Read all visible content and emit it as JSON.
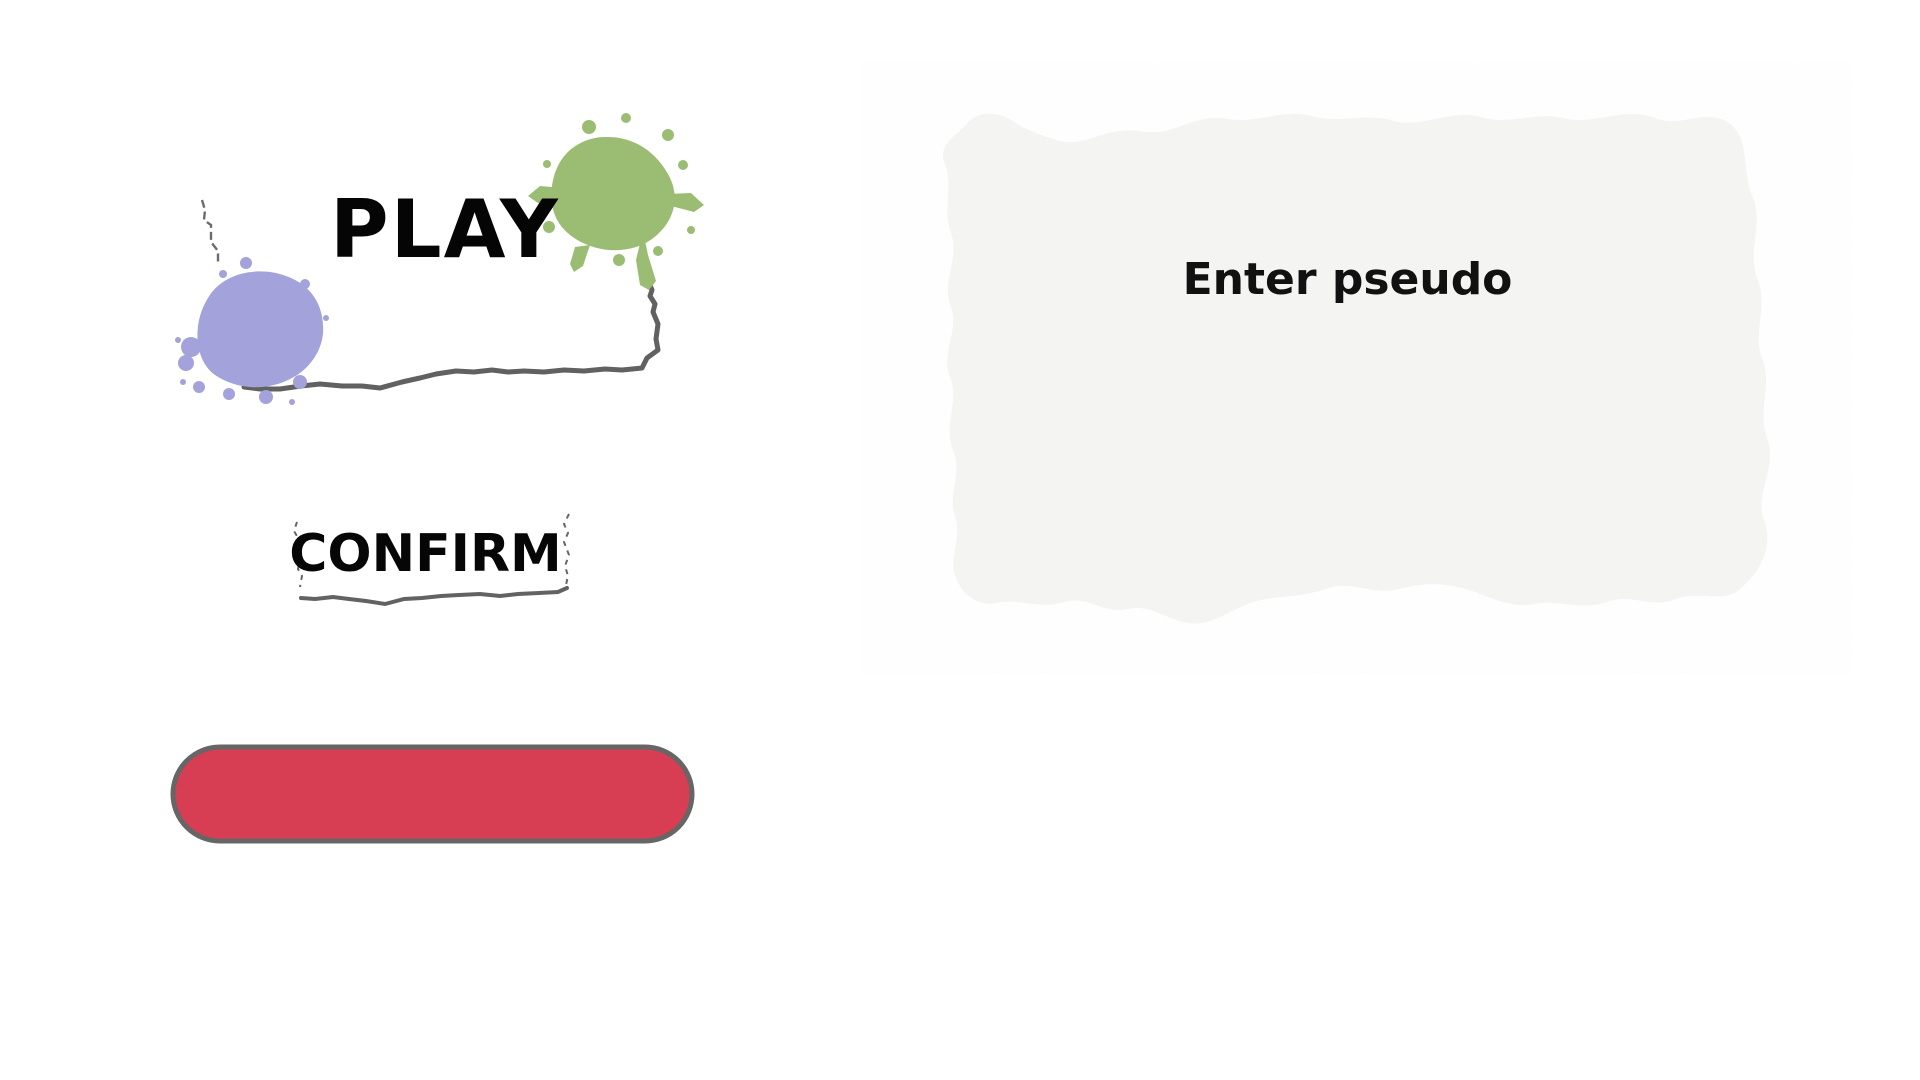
{
  "menu": {
    "play_label": "PLAY",
    "confirm_label": "CONFIRM",
    "red_bar_label": ""
  },
  "pseudo_panel": {
    "label": "Enter pseudo",
    "value": "",
    "placeholder": ""
  },
  "colors": {
    "background": "#ffffff",
    "text": "#050505",
    "paper": "#f5f5f3",
    "tear_shadow": "#5f5f5f",
    "purple_splatter": "#a3a2db",
    "green_splatter": "#9bbd73",
    "red_bar": "#d73e53",
    "red_bar_border": "#666666"
  },
  "icons": {
    "purple_splatter": "purple-paint-splatter-icon",
    "green_splatter": "green-paint-splatter-icon"
  }
}
